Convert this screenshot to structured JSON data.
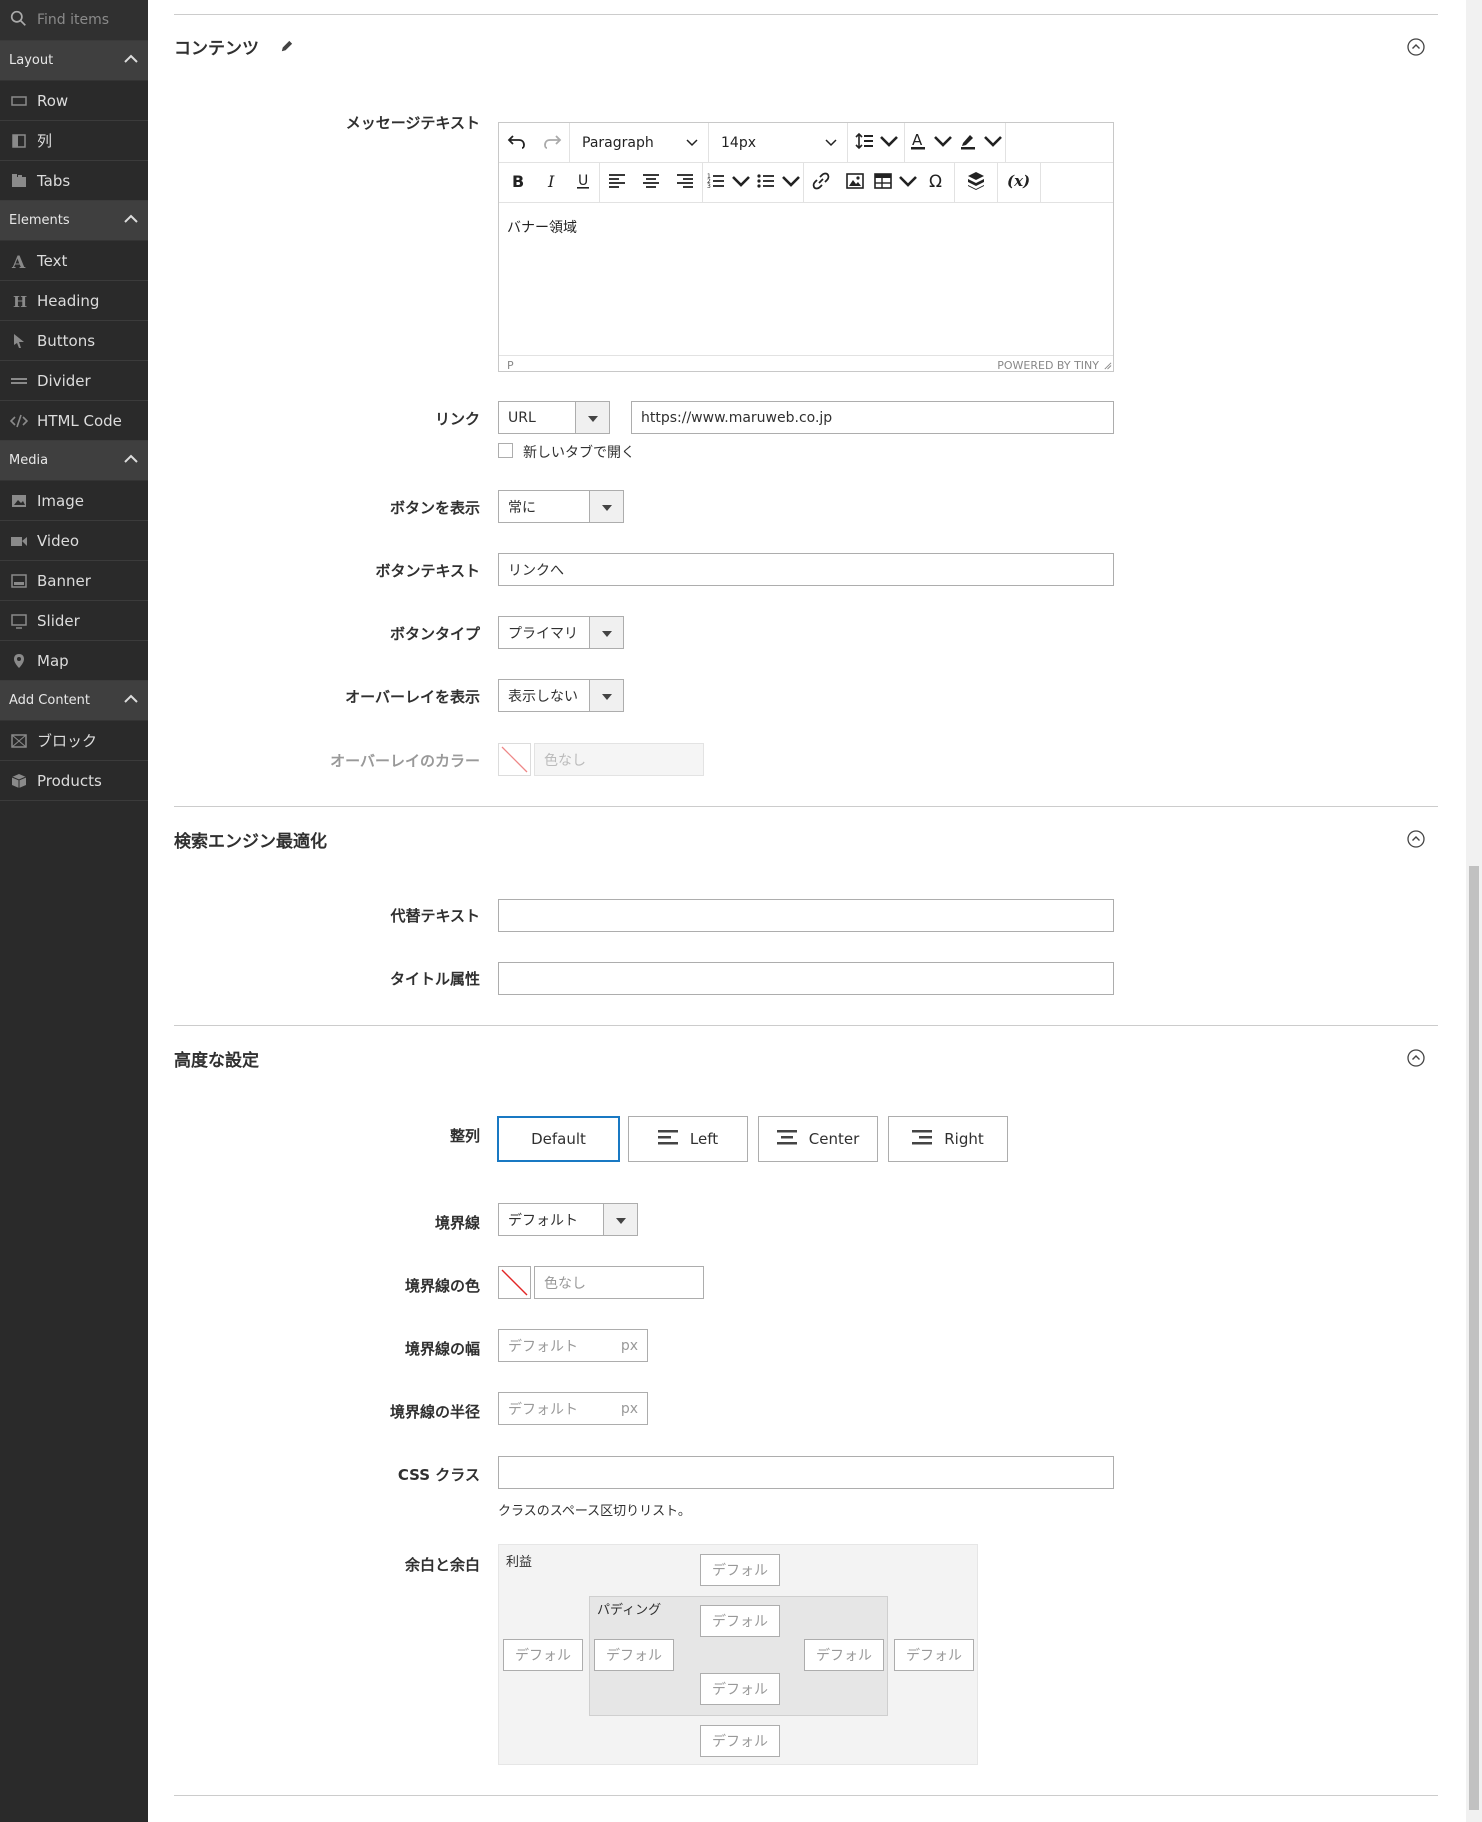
{
  "sidebar": {
    "search_placeholder": "Find items",
    "groups": [
      {
        "label": "Layout",
        "items": [
          {
            "label": "Row",
            "icon": "row-icon"
          },
          {
            "label": "列",
            "icon": "column-icon"
          },
          {
            "label": "Tabs",
            "icon": "tabs-icon"
          }
        ]
      },
      {
        "label": "Elements",
        "items": [
          {
            "label": "Text",
            "icon": "text-icon"
          },
          {
            "label": "Heading",
            "icon": "heading-icon"
          },
          {
            "label": "Buttons",
            "icon": "pointer-icon"
          },
          {
            "label": "Divider",
            "icon": "divider-icon"
          },
          {
            "label": "HTML Code",
            "icon": "code-icon"
          }
        ]
      },
      {
        "label": "Media",
        "items": [
          {
            "label": "Image",
            "icon": "image-icon"
          },
          {
            "label": "Video",
            "icon": "video-icon"
          },
          {
            "label": "Banner",
            "icon": "banner-icon"
          },
          {
            "label": "Slider",
            "icon": "slider-icon"
          },
          {
            "label": "Map",
            "icon": "map-pin-icon"
          }
        ]
      },
      {
        "label": "Add Content",
        "items": [
          {
            "label": "ブロック",
            "icon": "block-icon"
          },
          {
            "label": "Products",
            "icon": "products-icon"
          }
        ]
      }
    ]
  },
  "content": {
    "title": "コンテンツ",
    "message_label": "メッセージテキスト",
    "editor": {
      "block_format": "Paragraph",
      "font_size": "14px",
      "body": "バナー領域",
      "status_path": "P",
      "powered_by": "POWERED BY TINY"
    },
    "link_label": "リンク",
    "link_type": "URL",
    "link_value": "https://www.maruweb.co.jp",
    "new_tab_label": "新しいタブで開く",
    "show_button_label": "ボタンを表示",
    "show_button_value": "常に",
    "button_text_label": "ボタンテキスト",
    "button_text_value": "リンクへ",
    "button_type_label": "ボタンタイプ",
    "button_type_value": "プライマリ",
    "show_overlay_label": "オーバーレイを表示",
    "show_overlay_value": "表示しない",
    "overlay_color_label": "オーバーレイのカラー",
    "overlay_color_placeholder": "色なし"
  },
  "seo": {
    "title": "検索エンジン最適化",
    "alt_label": "代替テキスト",
    "alt_value": "",
    "title_attr_label": "タイトル属性",
    "title_attr_value": ""
  },
  "advanced": {
    "title": "高度な設定",
    "alignment_label": "整列",
    "alignment_options": [
      "Default",
      "Left",
      "Center",
      "Right"
    ],
    "alignment_selected": "Default",
    "border_label": "境界線",
    "border_value": "デフォルト",
    "border_color_label": "境界線の色",
    "border_color_placeholder": "色なし",
    "border_width_label": "境界線の幅",
    "border_width_placeholder": "デフォルト",
    "border_radius_label": "境界線の半径",
    "border_radius_placeholder": "デフォルト",
    "unit": "px",
    "css_class_label": "CSS クラス",
    "css_class_value": "",
    "css_class_note": "クラスのスペース区切りリスト。",
    "spacing_label": "余白と余白",
    "margin_label": "利益",
    "padding_label": "パディング",
    "spacing_placeholder": "デフォル"
  },
  "colors": {
    "accent": "#1979c3",
    "sidebar_bg": "#2a2a2a",
    "group_bg": "#3f3f3f",
    "no_color_slash": "#e22626"
  }
}
